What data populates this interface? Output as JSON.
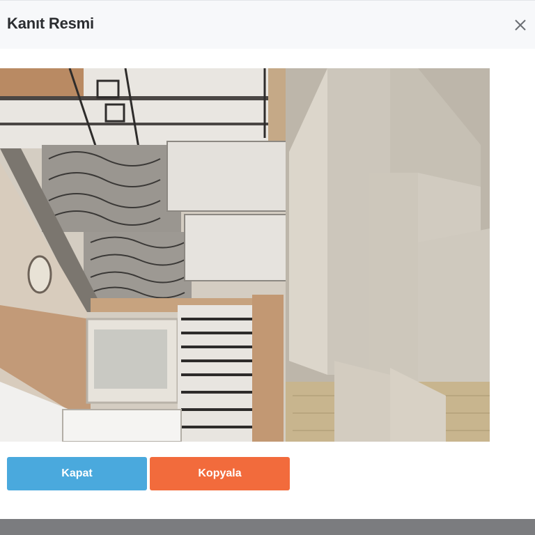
{
  "modal": {
    "title": "Kanıt Resmi",
    "close_icon": "close-icon"
  },
  "image": {
    "description_icon": "evidence-photo",
    "alt": "Kanıt Resmi"
  },
  "buttons": {
    "close_label": "Kapat",
    "copy_label": "Kopyala"
  },
  "colors": {
    "close_button": "#4aa9dd",
    "copy_button": "#f26b3c",
    "header_bg": "#f7f8fa",
    "overlay_bar": "#7b7c7f"
  }
}
